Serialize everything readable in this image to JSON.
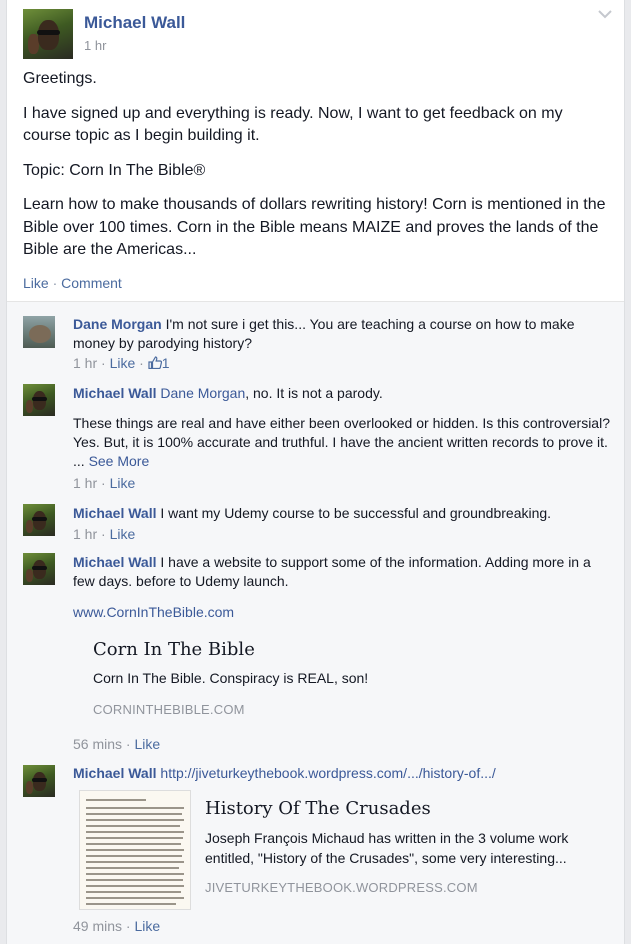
{
  "post": {
    "author": "Michael Wall",
    "time": "1 hr",
    "paragraphs": [
      "Greetings.",
      "I have signed up and everything is ready. Now, I want to get feedback on my course topic as I begin building it.",
      "Topic: Corn In The Bible®",
      "Learn how to make thousands of dollars rewriting history! Corn is mentioned in the Bible over 100 times. Corn in the Bible means MAIZE and proves the lands of the Bible are the Americas..."
    ],
    "like_label": "Like",
    "sep": " · ",
    "comment_label": "Comment"
  },
  "comments": [
    {
      "name": "Dane Morgan",
      "text": "I'm not sure i get this... You are teaching a course on how to make money by parodying history?",
      "time": "1 hr",
      "like": "Like",
      "likes": "1"
    },
    {
      "name": "Michael Wall",
      "mention": "Dane Morgan",
      "text": ", no. It is not a parody.",
      "text2": "These things are real and have either been overlooked or hidden. Is this controversial? Yes. But, it is 100% accurate and truthful. I have the ancient written records to prove it. ...",
      "see_more": "See More",
      "time": "1 hr",
      "like": "Like"
    },
    {
      "name": "Michael Wall",
      "text": "I want my Udemy course to be successful and groundbreaking.",
      "time": "1 hr",
      "like": "Like"
    },
    {
      "name": "Michael Wall",
      "text": "I have a website to support some of the information. Adding more in a few days. before to Udemy launch.",
      "link": "www.CornInTheBible.com",
      "share_title": "Corn In The Bible",
      "share_desc": "Corn In The Bible. Conspiracy is REAL, son!",
      "share_domain": "CORNINTHEBIBLE.COM",
      "time": "56 mins",
      "like": "Like"
    },
    {
      "name": "Michael Wall",
      "link": "http://jiveturkeythebook.wordpress.com/.../history-of.../",
      "share_title": "History Of The Crusades",
      "share_desc": "Joseph François Michaud has written in the 3 volume work entitled, \"History of the Crusades\", some very interesting...",
      "share_domain": "JIVETURKEYTHEBOOK.WORDPRESS.COM",
      "time": "49 mins",
      "like": "Like"
    }
  ],
  "icons": {
    "chevron": "chevron-down-icon",
    "thumb": "thumbs-up-icon"
  }
}
